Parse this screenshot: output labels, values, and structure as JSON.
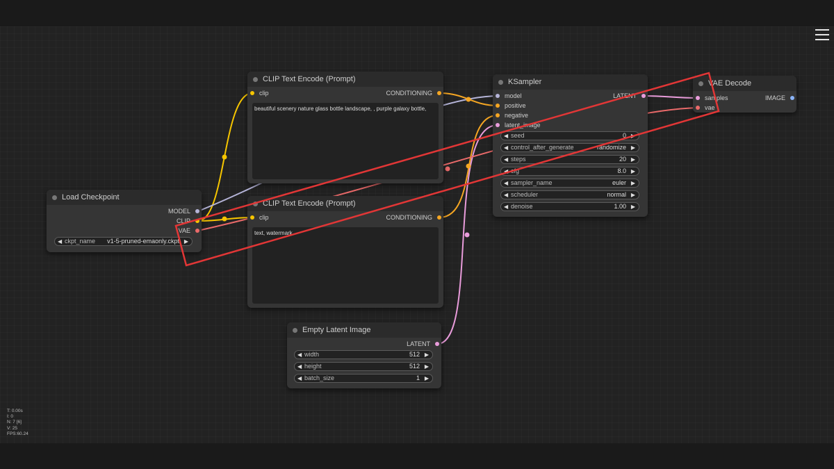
{
  "colors": {
    "clip": "#f6c500",
    "conditioning": "#f5a623",
    "model": "#b5b4d8",
    "vae": "#ea6a6a",
    "latent": "#e99cdb",
    "image": "#8ab4f8",
    "annotation": "#e23636"
  },
  "menu": {
    "icon": "hamburger-menu-icon"
  },
  "stats": {
    "t": "T: 0.00s",
    "i": "I: 0",
    "n": "N: 7 [6]",
    "v": "V: 25",
    "fps": "FPS:60.24"
  },
  "nodes": {
    "load_checkpoint": {
      "title": "Load Checkpoint",
      "outputs": [
        "MODEL",
        "CLIP",
        "VAE"
      ],
      "widget": {
        "label": "ckpt_name",
        "value": "v1-5-pruned-emaonly.ckpt"
      }
    },
    "clip_pos": {
      "title": "CLIP Text Encode (Prompt)",
      "input": "clip",
      "output": "CONDITIONING",
      "text": "beautiful scenery nature glass bottle landscape, , purple galaxy bottle,"
    },
    "clip_neg": {
      "title": "CLIP Text Encode (Prompt)",
      "input": "clip",
      "output": "CONDITIONING",
      "text": "text, watermark"
    },
    "ksampler": {
      "title": "KSampler",
      "inputs": [
        "model",
        "positive",
        "negative",
        "latent_image"
      ],
      "output": "LATENT",
      "widgets": [
        {
          "label": "seed",
          "value": "0"
        },
        {
          "label": "control_after_generate",
          "value": "randomize"
        },
        {
          "label": "steps",
          "value": "20"
        },
        {
          "label": "cfg",
          "value": "8.0"
        },
        {
          "label": "sampler_name",
          "value": "euler"
        },
        {
          "label": "scheduler",
          "value": "normal"
        },
        {
          "label": "denoise",
          "value": "1.00"
        }
      ]
    },
    "vae_decode": {
      "title": "VAE Decode",
      "inputs": [
        "samples",
        "vae"
      ],
      "output": "IMAGE"
    },
    "empty_latent": {
      "title": "Empty Latent Image",
      "output": "LATENT",
      "widgets": [
        {
          "label": "width",
          "value": "512"
        },
        {
          "label": "height",
          "value": "512"
        },
        {
          "label": "batch_size",
          "value": "1"
        }
      ]
    }
  }
}
